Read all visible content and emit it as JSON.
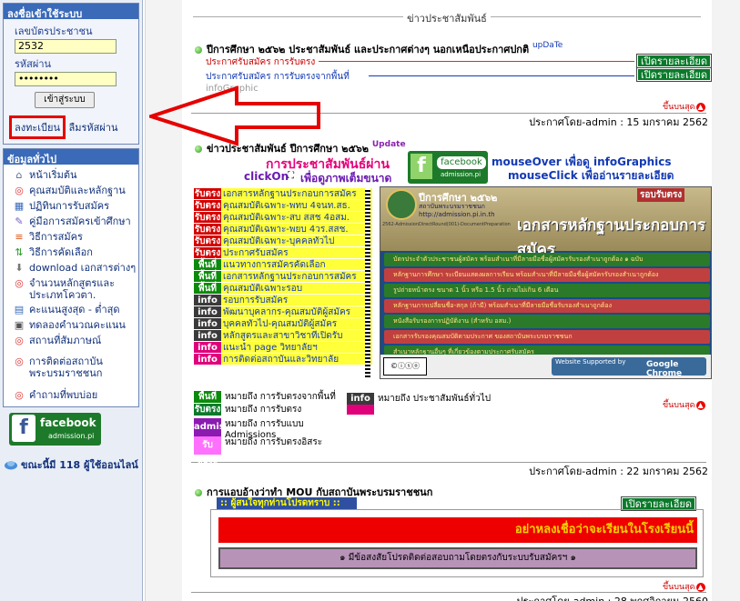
{
  "sidebar": {
    "login": {
      "title": "ลงชื่อเข้าใช้ระบบ",
      "id_label": "เลขบัตรประชาชน",
      "id_value": "2532",
      "pw_label": "รหัสผ่าน",
      "pw_value": "••••••••",
      "submit": "เข้าสู่ระบบ",
      "register": "ลงทะเบียน",
      "forgot": "ลืมรหัสผ่าน"
    },
    "info": {
      "title": "ข้อมูลทั่วไป",
      "items": [
        {
          "label": "หน้าเริ่มต้น",
          "icon": "home-icon"
        },
        {
          "label": "คุณสมบัติและหลักฐาน",
          "icon": "lifebuoy-icon"
        },
        {
          "label": "ปฏิทินการรับสมัคร",
          "icon": "calendar-icon"
        },
        {
          "label": "คู่มือการสมัครเข้าศึกษา",
          "icon": "manual-icon"
        },
        {
          "label": "วิธีการสมัคร",
          "icon": "document-icon"
        },
        {
          "label": "วิธีการคัดเลือก",
          "icon": "sort-icon"
        },
        {
          "label": "download เอกสารต่างๆ",
          "icon": "download-icon"
        },
        {
          "label": "จำนวนหลักสูตรและประเภทโควตา.",
          "icon": "lifebuoy-icon"
        },
        {
          "label": "คะแนนสูงสุด - ต่ำสุด",
          "icon": "chart-icon"
        },
        {
          "label": "ทดลองคำนวณคะแนน",
          "icon": "calculator-icon"
        },
        {
          "label": "สถานที่สัมภาษณ์",
          "icon": "lifebuoy-icon"
        },
        {
          "label": "การติดต่อสถาบันพระบรมราชชนก",
          "icon": "lifebuoy-icon"
        },
        {
          "label": "คำถามที่พบบ่อย",
          "icon": "lifebuoy-icon"
        }
      ]
    },
    "facebook": {
      "label": "facebook",
      "sub": "admission.pi"
    },
    "online": "ขณะนี้มี 118 ผู้ใช้ออนไลน์"
  },
  "main": {
    "section_title": "ข่าวประชาสัมพันธ์",
    "post1": {
      "title": "ปีการศึกษา ๒๕๖๒ ประชาสัมพันธ์ และประกาศต่างๆ นอกเหนือประกาศปกติ",
      "tag": "upDaTe",
      "line1": "ประกาศรับสมัคร การรับตรง",
      "line2": "ประกาศรับสมัคร การรับตรงจากพื้นที่",
      "line3": "infoGraphic",
      "button": "เปิดรายละเอียด",
      "back_top": "ขึ้นบนสุด",
      "poster": "ประกาศโดย-admin : 15 มกราคม 2562"
    },
    "post2": {
      "title": "ข่าวประชาสัมพันธ์ ปีการศึกษา ๒๕๖๒",
      "tag": "Update",
      "pr": "การประชาสัมพันธ์ผ่าน",
      "fb": "facebook",
      "fb_sub": "admission.pi",
      "mouseover": "mouseOver เพื่อดู infoGraphics",
      "mouseclick": "mouseClick เพื่ออ่านรายละเอียด",
      "clickon": "clickOn",
      "enlarge": "เพื่อดูภาพเต็มขนาด",
      "rows": [
        {
          "tag": "รับตรง",
          "text": "เอกสารหลักฐานประกอบการสมัคร",
          "c": "r"
        },
        {
          "tag": "รับตรง",
          "text": "คุณสมบัติเฉพาะ-พทบ 4จนท.สธ.",
          "c": "r"
        },
        {
          "tag": "รับตรง",
          "text": "คุณสมบัติเฉพาะ-สบ สสช 4อสม.",
          "c": "r"
        },
        {
          "tag": "รับตรง",
          "text": "คุณสมบัติเฉพาะ-พยบ 4วร.สสช.",
          "c": "r"
        },
        {
          "tag": "รับตรง",
          "text": "คุณสมบัติเฉพาะ-บุคคลทั่วไป",
          "c": "r"
        },
        {
          "tag": "รับตรง",
          "text": "ประกาศรับสมัคร",
          "c": "r"
        },
        {
          "tag": "พื้นที่",
          "text": "แนวทางการสมัครคัดเลือก",
          "c": "g"
        },
        {
          "tag": "พื้นที่",
          "text": "เอกสารหลักฐานประกอบการสมัคร",
          "c": "g"
        },
        {
          "tag": "พื้นที่",
          "text": "คุณสมบัติเฉพาะรอบ",
          "c": "g"
        },
        {
          "tag": "info",
          "text": "รอบการรับสมัคร",
          "c": "k"
        },
        {
          "tag": "info",
          "text": "พัฒนาบุคลากร-คุณสมบัติผู้สมัคร",
          "c": "k"
        },
        {
          "tag": "info",
          "text": "บุคคลทั่วไป-คุณสมบัติผู้สมัคร",
          "c": "k"
        },
        {
          "tag": "info",
          "text": "หลักสูตรและสาขาวิชาที่เปิดรับ",
          "c": "k"
        },
        {
          "tag": "info",
          "text": "แนะนำ page วิทยาลัยฯ",
          "c": "m"
        },
        {
          "tag": "info",
          "text": "การติดต่อสถาบันและวิทยาลัย",
          "c": "m"
        }
      ],
      "banner": {
        "year": "ปีการศึกษา ๒๕๖๒",
        "round": "รอบรับตรง",
        "org": "สถาบันพระบรมราชชนก",
        "url": "http://admission.pi.in.th",
        "code": "2562-AdmissionDirectRound(001)-DocumentPreparation",
        "headline": "เอกสารหลักฐานประกอบการสมัคร",
        "bullets": [
          "บัตรประจำตัวประชาชนผู้สมัคร พร้อมสำเนาที่มีลายมือชื่อผู้สมัครรับรองสำเนาถูกต้อง ๑ ฉบับ",
          "หลักฐานการศึกษา ระเบียนแสดงผลการเรียน พร้อมสำเนาที่มีลายมือชื่อผู้สมัครรับรองสำเนาถูกต้อง",
          "รูปถ่ายหน้าตรง ขนาด 1 นิ้ว หรือ 1.5 นิ้ว ถ่ายไม่เกิน 6 เดือน",
          "หลักฐานการเปลี่ยนชื่อ-สกุล (ถ้ามี) พร้อมสำเนาที่มีลายมือชื่อรับรองสำเนาถูกต้อง",
          "หนังสือรับรองการปฏิบัติงาน (สำหรับ อสม.)",
          "เอกสารรับรองคุณสมบัติตามประกาศ ของสถาบันพระบรมราชชนก",
          "สำเนาหลักฐานอื่นๆ ที่เกี่ยวข้องตามประกาศรับสมัคร"
        ],
        "supported": "Website Supported by",
        "chrome": "Google Chrome"
      },
      "legend": [
        {
          "tag": "พื้นที่",
          "text": "หมายถึง การรับตรงจากพื้นที่",
          "c": "g"
        },
        {
          "tag": "รับตรง",
          "text": "หมายถึง การรับตรง",
          "c": "r"
        },
        {
          "tag": "admis",
          "text": "หมายถึง การรับแบบ Admissions",
          "c": "m2"
        },
        {
          "tag": "รับอิสระ",
          "text": "หมายถึง การรับตรงอิสระ",
          "c": "pink"
        },
        {
          "tag": "info",
          "text": "หมายถึง ประชาสัมพันธ์ทั่วไป",
          "c": "k"
        }
      ],
      "back_top": "ขึ้นบนสุด",
      "poster": "ประกาศโดย-admin : 22 มกราคม 2562"
    },
    "post3": {
      "title": "การแอบอ้างว่าทำ MOU กับสถาบันพระบรมราชชนก",
      "box_title": ":: ผู้สนใจทุกท่านโปรดทราบ ::",
      "button": "เปิดรายละเอียด",
      "warning": "อย่าหลงเชื่อว่าจะเรียนในโรงเรียนนี้",
      "note": "๑ มีข้อสงสัยโปรดติดต่อสอบถามโดยตรงกับระบบรับสมัครฯ ๑",
      "back_top": "ขึ้นบนสุด",
      "poster": "ประกาศโดย-admin : 28 พฤศจิกายน 2560"
    }
  },
  "annotation": {
    "color": "#e60000"
  }
}
